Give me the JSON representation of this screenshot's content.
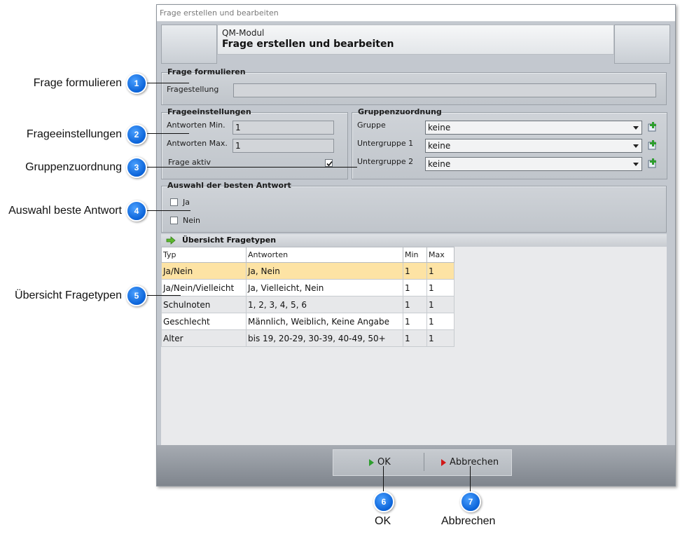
{
  "window": {
    "title": "Frage erstellen und bearbeiten",
    "header_subtitle": "QM-Modul",
    "header_title": "Frage erstellen und bearbeiten"
  },
  "frage_formulieren": {
    "group_title": "Frage formulieren",
    "label": "Fragestellung",
    "value": ""
  },
  "frageeinstellungen": {
    "group_title": "Frageeinstellungen",
    "min_label": "Antworten Min.",
    "min_value": "1",
    "max_label": "Antworten Max.",
    "max_value": "1",
    "active_label": "Frage aktiv",
    "active_checked": true
  },
  "gruppenzuordnung": {
    "group_title": "Gruppenzuordnung",
    "rows": [
      {
        "label": "Gruppe",
        "value": "keine"
      },
      {
        "label": "Untergruppe 1",
        "value": "keine"
      },
      {
        "label": "Untergruppe 2",
        "value": "keine"
      }
    ]
  },
  "auswahl": {
    "group_title": "Auswahl der besten Antwort",
    "options": [
      "Ja",
      "Nein"
    ]
  },
  "uebersicht": {
    "title": "Übersicht Fragetypen",
    "columns": [
      "Typ",
      "Antworten",
      "Min",
      "Max"
    ],
    "rows": [
      [
        "Ja/Nein",
        "Ja, Nein",
        "1",
        "1"
      ],
      [
        "Ja/Nein/Vielleicht",
        "Ja, Vielleicht, Nein",
        "1",
        "1"
      ],
      [
        "Schulnoten",
        "1, 2, 3, 4, 5, 6",
        "1",
        "1"
      ],
      [
        "Geschlecht",
        "Männlich, Weiblich, Keine Angabe",
        "1",
        "1"
      ],
      [
        "Alter",
        "bis 19, 20-29, 30-39, 40-49, 50+",
        "1",
        "1"
      ]
    ],
    "selected_row": 0
  },
  "buttons": {
    "ok": "OK",
    "cancel": "Abbrechen"
  },
  "callouts": [
    {
      "num": "1",
      "text": "Frage formulieren"
    },
    {
      "num": "2",
      "text": "Frageeinstellungen"
    },
    {
      "num": "3",
      "text": "Gruppenzuordnung"
    },
    {
      "num": "4",
      "text": "Auswahl beste Antwort"
    },
    {
      "num": "5",
      "text": "Übersicht Fragetypen"
    },
    {
      "num": "6",
      "text": "OK"
    },
    {
      "num": "7",
      "text": "Abbrechen"
    }
  ],
  "colors": {
    "badge": "#0b63d8",
    "selected_row": "#fde3a4",
    "ok_icon": "#2e9e2e",
    "cancel_icon": "#d01818",
    "add_icon": "#2e9e2e"
  }
}
